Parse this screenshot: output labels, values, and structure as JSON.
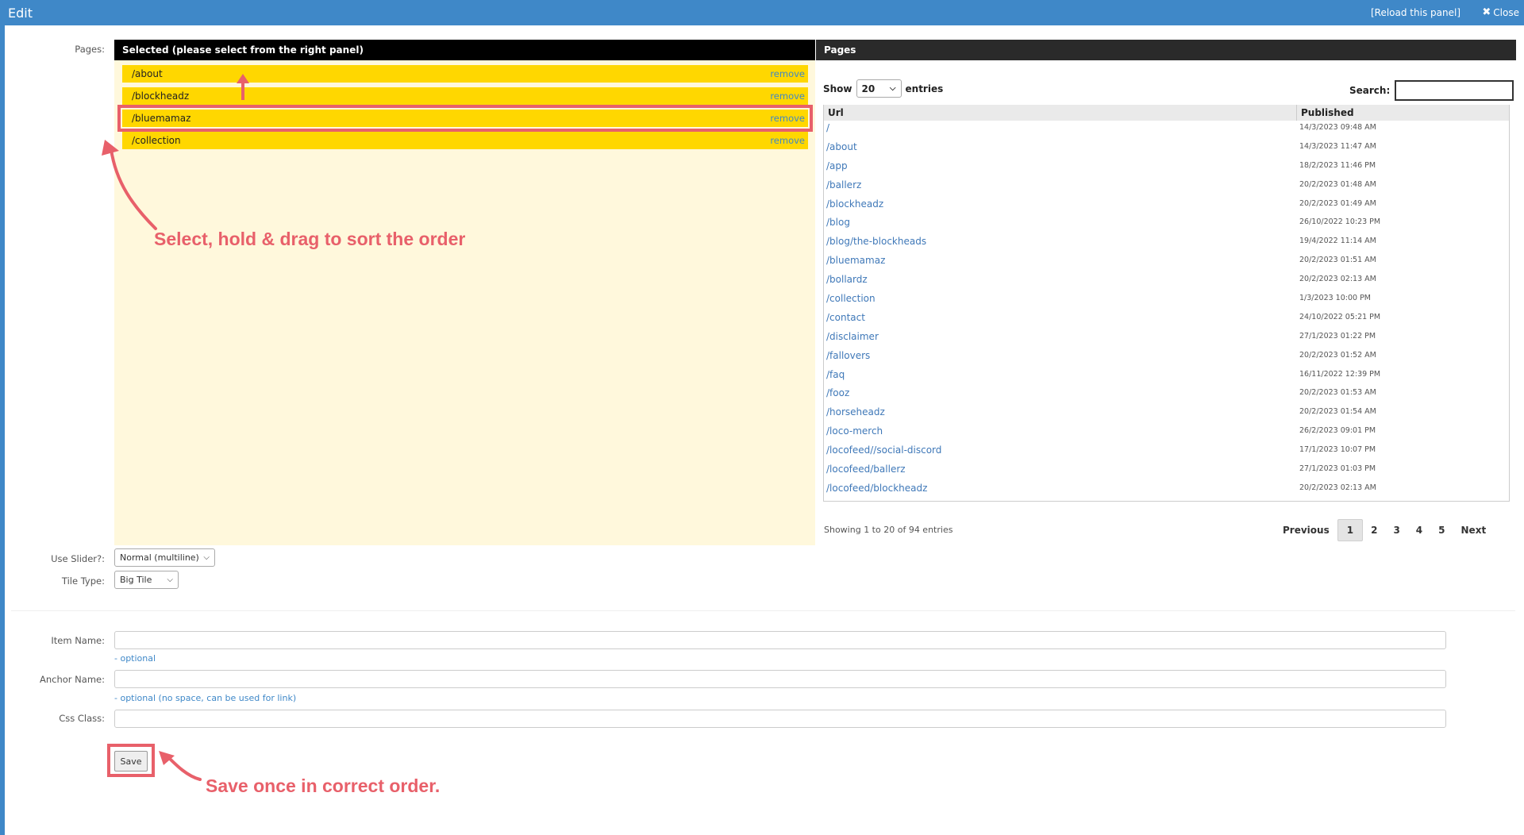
{
  "window": {
    "title": "Edit",
    "reload_label": "[Reload this panel]",
    "close_label": "Close",
    "accent_color": "#3f88c8"
  },
  "form": {
    "pages_label": "Pages:",
    "use_slider_label": "Use Slider?:",
    "use_slider_value": "Normal (multiline)",
    "tile_type_label": "Tile Type:",
    "tile_type_value": "Big Tile",
    "item_name_label": "Item Name:",
    "item_name_value": "",
    "item_name_hint": "- optional",
    "anchor_name_label": "Anchor Name:",
    "anchor_name_value": "",
    "anchor_name_hint": "- optional (no space, can be used for link)",
    "css_class_label": "Css Class:",
    "css_class_value": "",
    "save_label": "Save"
  },
  "selected": {
    "header": "Selected (please select from the right panel)",
    "remove_label": "remove",
    "items": [
      "/about",
      "/blockheadz",
      "/bluemamaz",
      "/collection"
    ],
    "item_color": "#ffd700",
    "panel_color": "#fff8dc"
  },
  "pages": {
    "header": "Pages",
    "show_label": "Show",
    "entries_value": "20",
    "entries_label": "entries",
    "search_label": "Search:",
    "search_value": "",
    "columns": [
      "Url",
      "Published"
    ],
    "rows": [
      {
        "url": "/",
        "published": "14/3/2023 09:48 AM"
      },
      {
        "url": "/about",
        "published": "14/3/2023 11:47 AM"
      },
      {
        "url": "/app",
        "published": "18/2/2023 11:46 PM"
      },
      {
        "url": "/ballerz",
        "published": "20/2/2023 01:48 AM"
      },
      {
        "url": "/blockheadz",
        "published": "20/2/2023 01:49 AM"
      },
      {
        "url": "/blog",
        "published": "26/10/2022 10:23 PM"
      },
      {
        "url": "/blog/the-blockheads",
        "published": "19/4/2022 11:14 AM"
      },
      {
        "url": "/bluemamaz",
        "published": "20/2/2023 01:51 AM"
      },
      {
        "url": "/bollardz",
        "published": "20/2/2023 02:13 AM"
      },
      {
        "url": "/collection",
        "published": "1/3/2023 10:00 PM"
      },
      {
        "url": "/contact",
        "published": "24/10/2022 05:21 PM"
      },
      {
        "url": "/disclaimer",
        "published": "27/1/2023 01:22 PM"
      },
      {
        "url": "/fallovers",
        "published": "20/2/2023 01:52 AM"
      },
      {
        "url": "/faq",
        "published": "16/11/2022 12:39 PM"
      },
      {
        "url": "/fooz",
        "published": "20/2/2023 01:53 AM"
      },
      {
        "url": "/horseheadz",
        "published": "20/2/2023 01:54 AM"
      },
      {
        "url": "/loco-merch",
        "published": "26/2/2023 09:01 PM"
      },
      {
        "url": "/locofeed//social-discord",
        "published": "17/1/2023 10:07 PM"
      },
      {
        "url": "/locofeed/ballerz",
        "published": "27/1/2023 01:03 PM"
      },
      {
        "url": "/locofeed/blockheadz",
        "published": "20/2/2023 02:13 AM"
      }
    ],
    "info": "Showing 1 to 20 of 94 entries",
    "pagination": {
      "previous": "Previous",
      "pages": [
        "1",
        "2",
        "3",
        "4",
        "5"
      ],
      "current": "1",
      "next": "Next"
    }
  },
  "annotations": {
    "drag_note": "Select, hold & drag to sort the order",
    "save_note": "Save once in correct order.",
    "color": "#e8606a"
  }
}
